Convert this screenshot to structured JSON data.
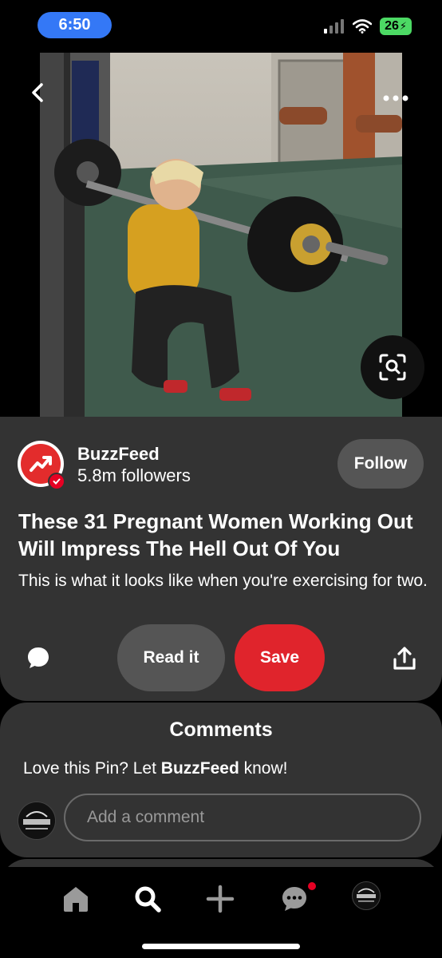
{
  "status_bar": {
    "time": "6:50",
    "battery": "26"
  },
  "creator": {
    "name": "BuzzFeed",
    "followers": "5.8m followers",
    "follow_label": "Follow"
  },
  "pin": {
    "title": "These 31 Pregnant Women Working Out Will Impress The Hell Out Of You",
    "description": "This is what it looks like when you're exercising for two.",
    "read_label": "Read it",
    "save_label": "Save"
  },
  "comments": {
    "heading": "Comments",
    "prompt_prefix": "Love this Pin? Let ",
    "prompt_name": "BuzzFeed",
    "prompt_suffix": " know!",
    "placeholder": "Add a comment"
  },
  "colors": {
    "accent_red": "#e0242c",
    "card_bg": "#333333",
    "status_blue": "#3478f6",
    "battery_green": "#4cd964"
  },
  "icons": [
    "back-icon",
    "more-icon",
    "visual-search-icon",
    "comment-icon",
    "share-icon",
    "home-icon",
    "search-icon",
    "create-icon",
    "messages-icon"
  ]
}
